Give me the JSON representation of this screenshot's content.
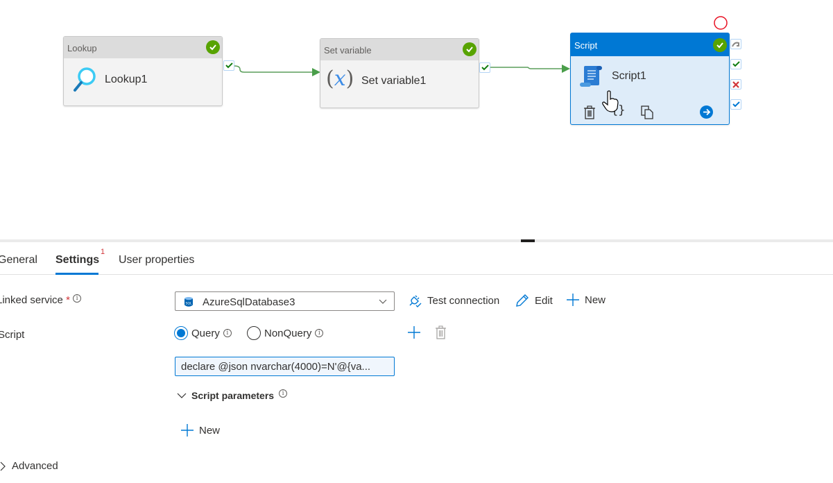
{
  "pipeline": {
    "activities": [
      {
        "type": "Lookup",
        "name": "Lookup1",
        "status": "succeeded",
        "icon": "magnifier-icon"
      },
      {
        "type": "Set variable",
        "name": "Set variable1",
        "status": "succeeded",
        "icon": "variable-x-icon"
      },
      {
        "type": "Script",
        "name": "Script1",
        "status": "succeeded",
        "icon": "script-scroll-icon",
        "selected": true
      }
    ],
    "connections": [
      {
        "from": "Lookup1",
        "to": "Set variable1",
        "condition": "success"
      },
      {
        "from": "Set variable1",
        "to": "Script1",
        "condition": "success"
      }
    ],
    "selected_actions": [
      "delete-icon",
      "code-icon",
      "copy-icon",
      "go-to-icon"
    ],
    "side_ports": [
      "skip",
      "success",
      "failure",
      "completion"
    ]
  },
  "tabs": [
    {
      "label": "General"
    },
    {
      "label": "Settings",
      "badge": "1",
      "active": true
    },
    {
      "label": "User properties"
    }
  ],
  "settings": {
    "linked_service": {
      "label": "Linked service",
      "required_mark": "*",
      "value": "AzureSqlDatabase3",
      "test_connection": "Test connection",
      "edit": "Edit",
      "new": "New"
    },
    "script": {
      "label": "Script",
      "options": [
        {
          "label": "Query",
          "selected": true
        },
        {
          "label": "NonQuery",
          "selected": false
        }
      ],
      "value": "declare @json nvarchar(4000)=N'@{va..."
    },
    "script_parameters": {
      "label": "Script parameters",
      "new": "New"
    },
    "advanced": {
      "label": "Advanced"
    }
  },
  "colors": {
    "accent": "#0078d4",
    "success": "#57a300",
    "failure": "#d13438"
  }
}
